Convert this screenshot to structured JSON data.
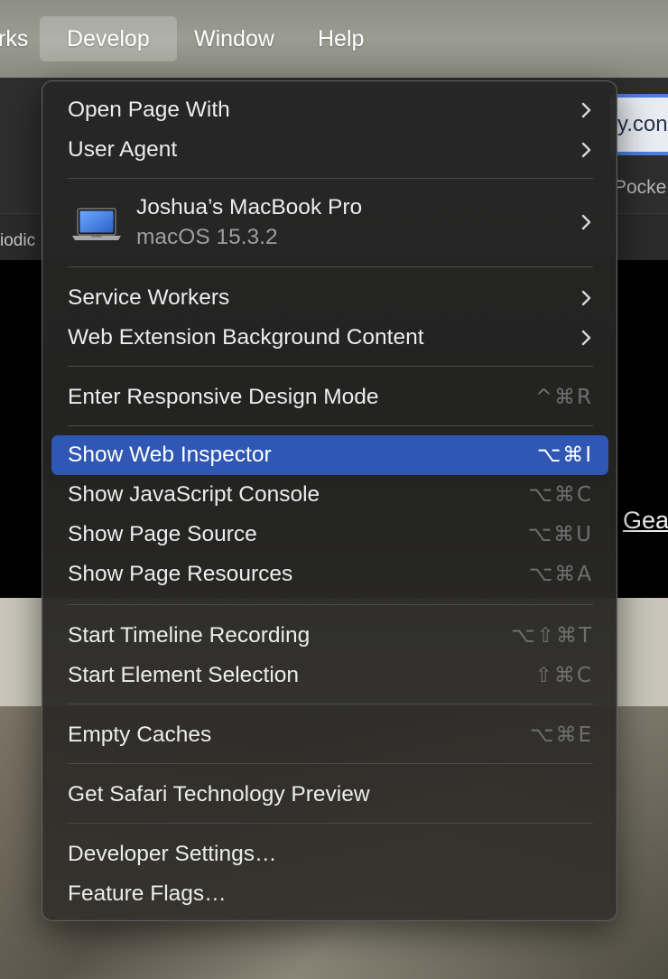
{
  "menubar": {
    "items": [
      {
        "label": "rks"
      },
      {
        "label": "Develop"
      },
      {
        "label": "Window"
      },
      {
        "label": "Help"
      }
    ]
  },
  "browser": {
    "url_fragment": "y.con",
    "pocket_fragment": "Pocke",
    "tab_fragment": "iodic"
  },
  "page": {
    "link_fragment": "Gea"
  },
  "menu": {
    "open_page_with": "Open Page With",
    "user_agent": "User Agent",
    "device": {
      "name": "Joshua’s MacBook Pro",
      "os": "macOS 15.3.2"
    },
    "service_workers": "Service Workers",
    "web_extension_background": "Web Extension Background Content",
    "responsive_design": {
      "label": "Enter Responsive Design Mode",
      "shortcut": "^⌘R"
    },
    "show_web_inspector": {
      "label": "Show Web Inspector",
      "shortcut": "⌥⌘I"
    },
    "show_js_console": {
      "label": "Show JavaScript Console",
      "shortcut": "⌥⌘C"
    },
    "show_page_source": {
      "label": "Show Page Source",
      "shortcut": "⌥⌘U"
    },
    "show_page_resources": {
      "label": "Show Page Resources",
      "shortcut": "⌥⌘A"
    },
    "start_timeline": {
      "label": "Start Timeline Recording",
      "shortcut": "⌥⇧⌘T"
    },
    "start_element_selection": {
      "label": "Start Element Selection",
      "shortcut": "⇧⌘C"
    },
    "empty_caches": {
      "label": "Empty Caches",
      "shortcut": "⌥⌘E"
    },
    "get_stp": "Get Safari Technology Preview",
    "developer_settings": "Developer Settings…",
    "feature_flags": "Feature Flags…"
  },
  "colors": {
    "highlight": "#2f57b3",
    "menu_bg": "#262626",
    "shortcut_disabled": "#6f6f6f"
  }
}
